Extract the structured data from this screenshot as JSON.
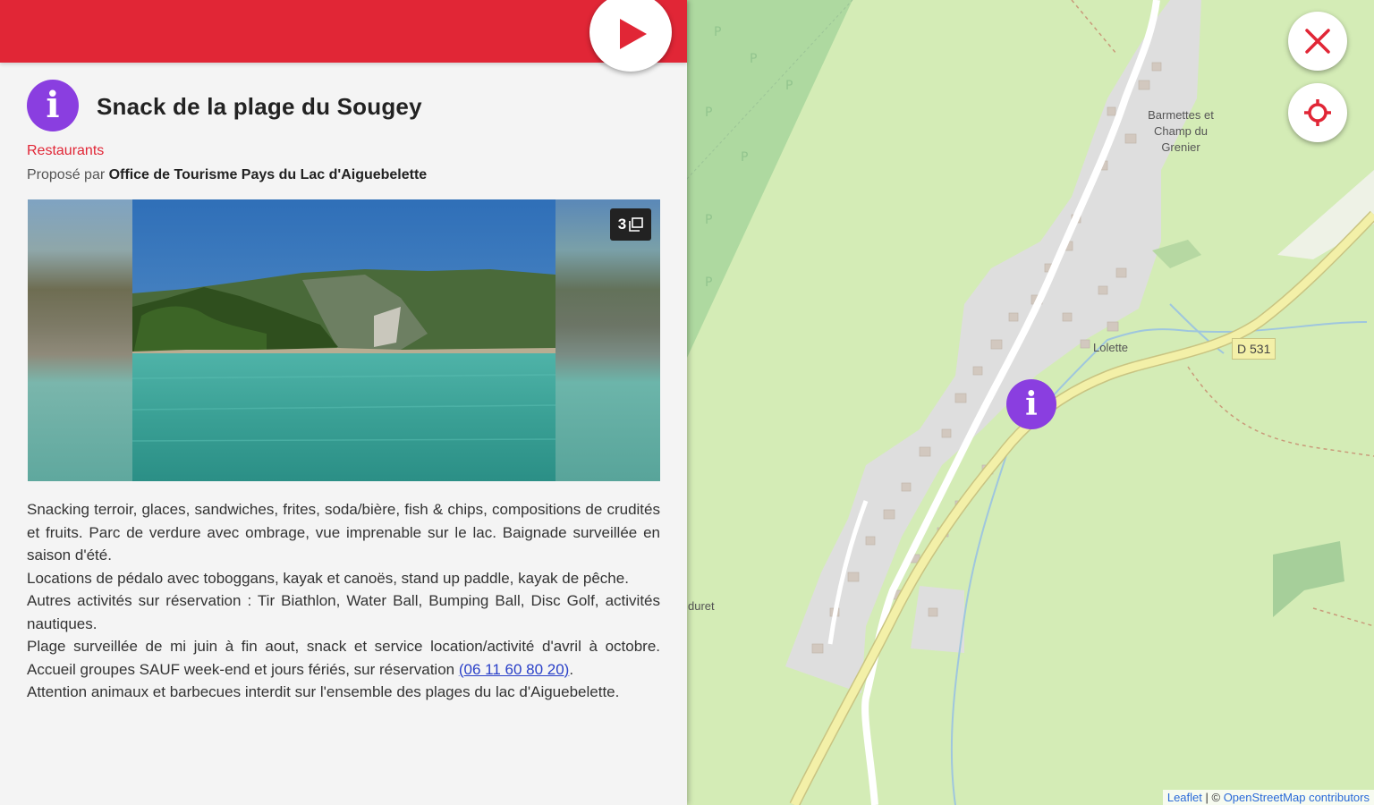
{
  "header": {
    "play_button_label": "Play",
    "play_icon": "play-icon"
  },
  "poi": {
    "icon": "info-icon",
    "icon_glyph": "i",
    "title": "Snack de la plage du Sougey",
    "category": "Restaurants",
    "provider_prefix": "Proposé par ",
    "provider_name": "Office de Tourisme Pays du Lac d'Aiguebelette",
    "accent_color": "#8a3ee0",
    "brand_color": "#e12636"
  },
  "gallery": {
    "photo_count": "3",
    "count_icon": "images-icon"
  },
  "description": {
    "p1": "Snacking terroir, glaces, sandwiches, frites, soda/bière, fish & chips, compositions de crudités et fruits. Parc de verdure avec ombrage, vue imprenable sur le lac. Baignade surveillée en saison d'été.",
    "p2": "Locations de pédalo avec toboggans, kayak et canoës, stand up paddle, kayak de pêche.",
    "p3": "Autres activités sur réservation : Tir Biathlon, Water Ball, Bumping Ball, Disc Golf, activités nautiques.",
    "p4_before": "Plage surveillée de mi juin à fin aout, snack et service location/activité d'avril à octobre. Accueil groupes SAUF week-end et jours fériés, sur réservation ",
    "p4_link": "(06 11 60 80 20)",
    "p4_after": ".",
    "p5": "Attention animaux et barbecues interdit sur l'ensemble des plages du lac d'Aiguebelette."
  },
  "map": {
    "close_icon": "close-icon",
    "locate_icon": "crosshair-icon",
    "marker_glyph": "i",
    "labels": {
      "barmettes": "Barmettes et Champ du Grenier",
      "lolette": "Lolette",
      "road": "D 531",
      "duret": "duret"
    },
    "attribution": {
      "leaflet": "Leaflet",
      "separator": " | © ",
      "osm": "OpenStreetMap contributors"
    }
  }
}
